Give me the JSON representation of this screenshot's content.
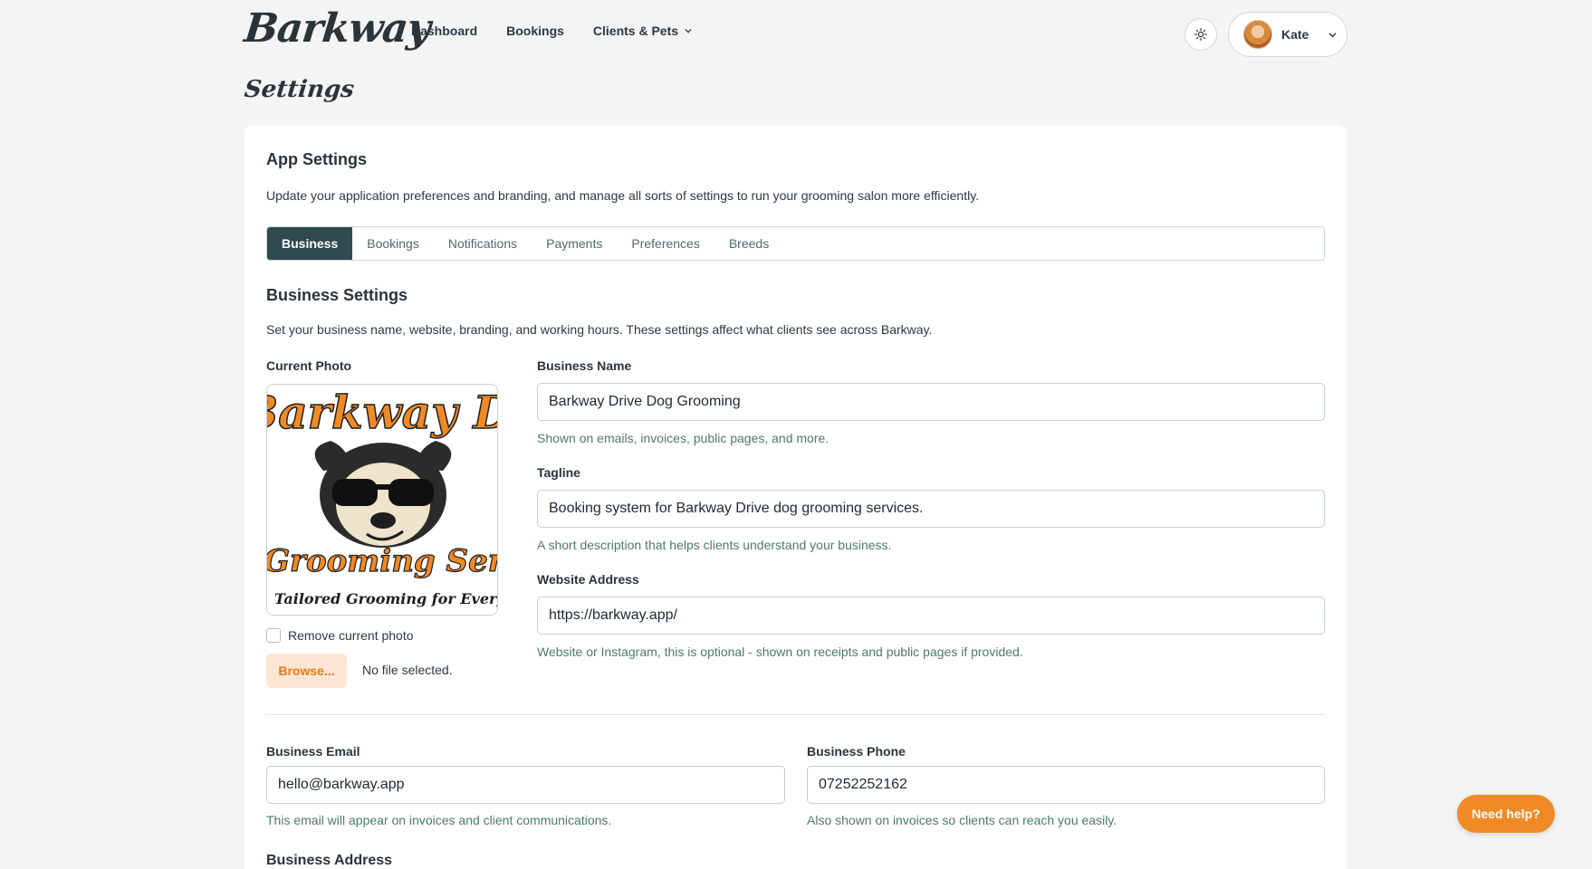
{
  "header": {
    "logo": "Barkway",
    "nav": [
      {
        "label": "Dashboard"
      },
      {
        "label": "Bookings"
      },
      {
        "label": "Clients & Pets"
      }
    ],
    "user_name": "Kate"
  },
  "page_title": "Settings",
  "app_settings": {
    "title": "App Settings",
    "description": "Update your application preferences and branding, and manage all sorts of settings to run your grooming salon more efficiently.",
    "tabs": [
      "Business",
      "Bookings",
      "Notifications",
      "Payments",
      "Preferences",
      "Breeds"
    ],
    "active_tab": "Business"
  },
  "business_settings": {
    "title": "Business Settings",
    "description": "Set your business name, website, branding, and working hours. These settings affect what clients see across Barkway.",
    "photo": {
      "label": "Current Photo",
      "logo_text_top": "Barkway Drive",
      "logo_text_mid": "Grooming Services",
      "logo_text_bottom": "Tailored Grooming for Every Pup",
      "remove_label": "Remove current photo",
      "browse_label": "Browse...",
      "file_status": "No file selected."
    },
    "business_name": {
      "label": "Business Name",
      "value": "Barkway Drive Dog Grooming",
      "help": "Shown on emails, invoices, public pages, and more."
    },
    "tagline": {
      "label": "Tagline",
      "value": "Booking system for Barkway Drive dog grooming services.",
      "help": "A short description that helps clients understand your business."
    },
    "website": {
      "label": "Website Address",
      "value": "https://barkway.app/",
      "help": "Website or Instagram, this is optional - shown on receipts and public pages if provided."
    },
    "email": {
      "label": "Business Email",
      "value": "hello@barkway.app",
      "help": "This email will appear on invoices and client communications."
    },
    "phone": {
      "label": "Business Phone",
      "value": "07252252162",
      "help": "Also shown on invoices so clients can reach you easily."
    },
    "address_label": "Business Address"
  },
  "help_button": "Need help?",
  "colors": {
    "accent": "#f08a24",
    "tab_active": "#2f4a50",
    "help_text": "#4e7a6a"
  }
}
